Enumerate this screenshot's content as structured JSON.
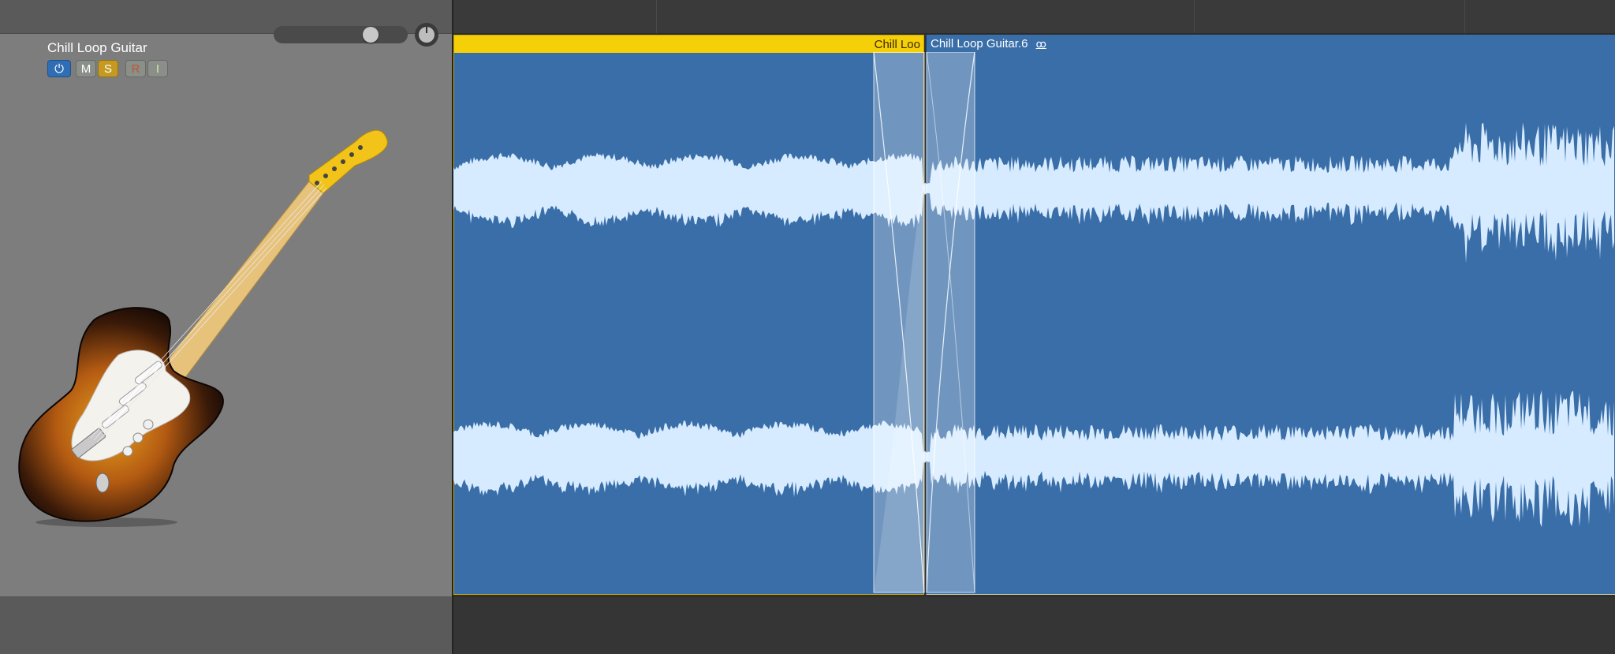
{
  "track": {
    "name": "Chill Loop Guitar",
    "buttons": {
      "power_icon": "power-icon",
      "mute": "M",
      "solo": "S",
      "record": "R",
      "input": "I"
    },
    "volume_level": 0.75,
    "pan_value": 0
  },
  "regions": [
    {
      "label": "Chill Loo",
      "selected": true,
      "color": "#f5cf08"
    },
    {
      "label": "Chill Loop Guitar.6",
      "loop_icon": "loop-icon",
      "selected": false
    }
  ],
  "colors": {
    "region_fill": "#3a6ea8",
    "waveform": "#d6ebff",
    "selected_header": "#f5cf08",
    "solo_active": "#c49a22",
    "power_active": "#2f6eb5"
  }
}
